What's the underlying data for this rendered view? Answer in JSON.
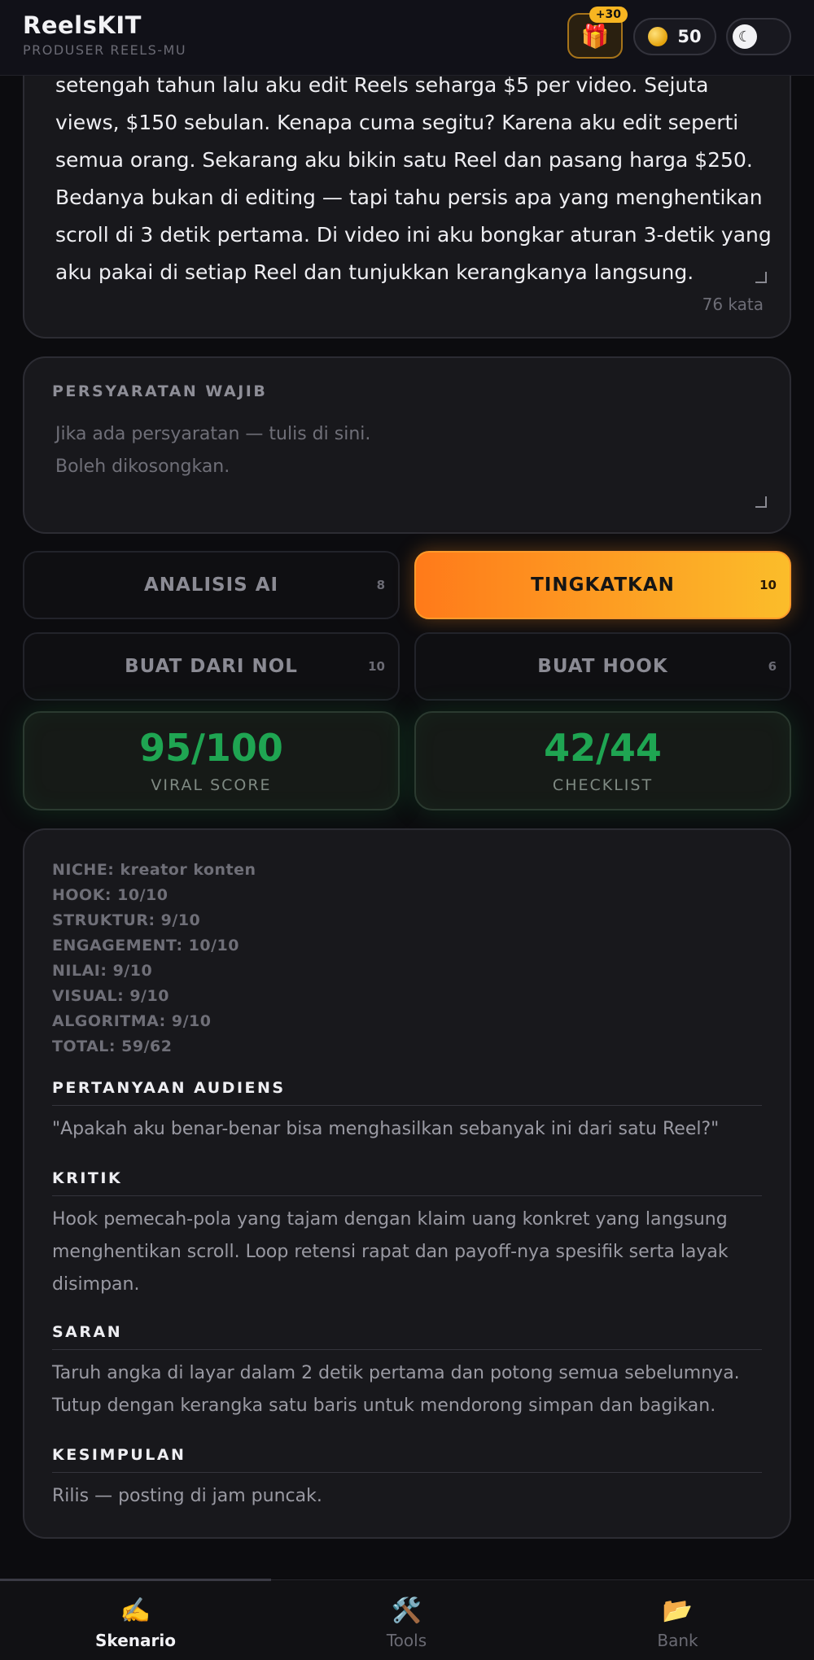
{
  "header": {
    "title": "ReelsKIT",
    "subtitle": "PRODUSER REELS-MU",
    "gift_icon": "gift-icon",
    "gift_badge": "+30",
    "coin_icon": "coin-icon",
    "coins": "50",
    "theme_icon": "moon-icon",
    "theme_glyph": "☾"
  },
  "script": {
    "text": "setengah tahun lalu aku edit Reels seharga $5 per video. Sejuta views, $150 sebulan. Kenapa cuma segitu? Karena aku edit seperti semua orang. Sekarang aku bikin satu Reel dan pasang harga $250. Bedanya bukan di editing — tapi tahu persis apa yang menghentikan scroll di 3 detik pertama. Di video ini aku bongkar aturan 3-detik yang aku pakai di setiap Reel dan tunjukkan kerangkanya langsung.",
    "word_count": "76 kata"
  },
  "requirements": {
    "label": "PERSYARATAN WAJIB",
    "placeholder_line1": "Jika ada persyaratan — tulis di sini.",
    "placeholder_line2": "Boleh dikosongkan."
  },
  "actions": [
    {
      "label": "ANALISIS AI",
      "cost": "8"
    },
    {
      "label": "TINGKATKAN",
      "cost": "10"
    },
    {
      "label": "BUAT DARI NOL",
      "cost": "10"
    },
    {
      "label": "BUAT HOOK",
      "cost": "6"
    }
  ],
  "scores": {
    "viral_value": "95/100",
    "viral_label": "VIRAL SCORE",
    "checklist_value": "42/44",
    "checklist_label": "CHECKLIST",
    "accent_color": "#1fa552"
  },
  "analysis": {
    "stats": [
      "NICHE: kreator konten",
      "HOOK: 10/10",
      "STRUKTUR: 9/10",
      "ENGAGEMENT: 10/10",
      "NILAI: 9/10",
      "VISUAL: 9/10",
      "ALGORITMA: 9/10",
      "TOTAL: 59/62"
    ],
    "audience_question_heading": "PERTANYAAN AUDIENS",
    "audience_question": "\"Apakah aku benar-benar bisa menghasilkan sebanyak ini dari satu Reel?\"",
    "critique_heading": "KRITIK",
    "critique": "Hook pemecah-pola yang tajam dengan klaim uang konkret yang langsung menghentikan scroll. Loop retensi rapat dan payoff-nya spesifik serta layak disimpan.",
    "advice_heading": "SARAN",
    "advice": "Taruh angka di layar dalam 2 detik pertama dan potong semua sebelumnya. Tutup dengan kerangka satu baris untuk mendorong simpan dan bagikan.",
    "conclusion_heading": "KESIMPULAN",
    "conclusion": "Rilis — posting di jam puncak."
  },
  "nav": [
    {
      "label": "Skenario",
      "icon": "pen-icon",
      "glyph": "✍️"
    },
    {
      "label": "Tools",
      "icon": "tools-icon",
      "glyph": "🛠️"
    },
    {
      "label": "Bank",
      "icon": "folder-icon",
      "glyph": "📂"
    }
  ],
  "colors": {
    "accent_orange": "#ff7a1a",
    "accent_yellow": "#fbbd2a",
    "background": "#0c0c0f"
  }
}
